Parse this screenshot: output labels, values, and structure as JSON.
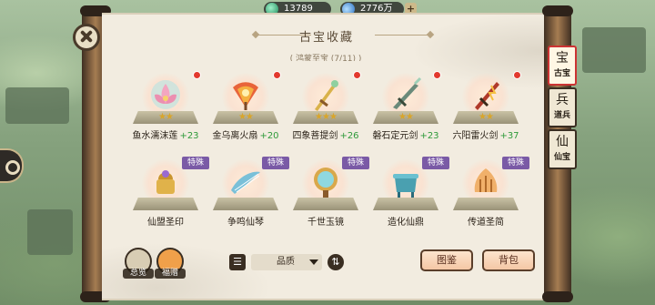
{
  "resources": [
    {
      "icon": "jade-icon",
      "value": "13789"
    },
    {
      "icon": "water-drop-icon",
      "value": "2776万"
    }
  ],
  "panel": {
    "title": "古宝收藏",
    "partial_subtitle": "( 鸿蒙至宝 (7/11) )"
  },
  "items": [
    {
      "name": "鱼水濡沫莲",
      "bonus": "+23",
      "stars": "★★",
      "badge": "",
      "red_dot": true
    },
    {
      "name": "金乌离火扇",
      "bonus": "+20",
      "stars": "★★",
      "badge": "",
      "red_dot": true
    },
    {
      "name": "四象菩提剑",
      "bonus": "+26",
      "stars": "★★★",
      "badge": "",
      "red_dot": true
    },
    {
      "name": "磐石定元剑",
      "bonus": "+23",
      "stars": "★★",
      "badge": "",
      "red_dot": true
    },
    {
      "name": "六阳雷火剑",
      "bonus": "+37",
      "stars": "★★",
      "badge": "",
      "red_dot": true
    },
    {
      "name": "仙盟圣印",
      "bonus": "",
      "stars": "",
      "badge": "特殊",
      "red_dot": false
    },
    {
      "name": "争鸣仙琴",
      "bonus": "",
      "stars": "",
      "badge": "特殊",
      "red_dot": false
    },
    {
      "name": "千世玉镜",
      "bonus": "",
      "stars": "",
      "badge": "特殊",
      "red_dot": false
    },
    {
      "name": "造化仙鼎",
      "bonus": "",
      "stars": "",
      "badge": "特殊",
      "red_dot": false
    },
    {
      "name": "传道圣简",
      "bonus": "",
      "stars": "",
      "badge": "特殊",
      "red_dot": false
    }
  ],
  "tabs": [
    {
      "label": "古宝",
      "glyph": "宝",
      "active": true
    },
    {
      "label": "道兵",
      "glyph": "兵",
      "active": false
    },
    {
      "label": "仙宝",
      "glyph": "仙",
      "active": false
    }
  ],
  "bottom": {
    "overview_label": "总览",
    "blessing_label": "福赠",
    "quality_select": "品质",
    "illustrated_label": "图鉴",
    "bag_label": "背包"
  },
  "colors": {
    "bonus_green": "#2f9a3a",
    "red_dot": "#e2392e",
    "special_badge": "#7a5aa6",
    "star_gold": "#d9a52a"
  }
}
